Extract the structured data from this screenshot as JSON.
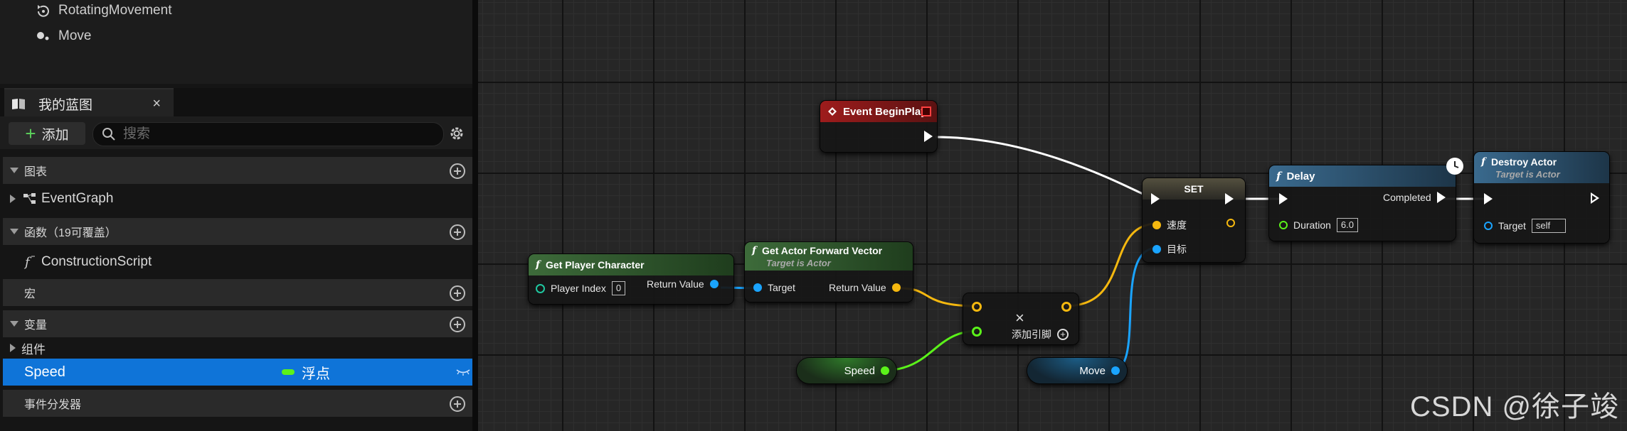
{
  "components": [
    {
      "label": "RotatingMovement",
      "icon": "rotating-movement-icon"
    },
    {
      "label": "Move",
      "icon": "move-component-icon"
    }
  ],
  "panel": {
    "tab_title": "我的蓝图",
    "close": "×",
    "add_label": "添加",
    "search_placeholder": "搜索"
  },
  "sections": {
    "graphs": "图表",
    "event_graph": "EventGraph",
    "functions": "函数（19可覆盖）",
    "construction_script": "ConstructionScript",
    "macros": "宏",
    "variables": "变量",
    "components_cat": "组件",
    "dispatchers": "事件分发器"
  },
  "variable": {
    "name": "Speed",
    "type": "浮点",
    "type_color": "#5bf21a"
  },
  "graph": {
    "begin_play": {
      "title": "Event BeginPlay"
    },
    "get_player": {
      "title": "Get Player Character",
      "player_index_label": "Player Index",
      "player_index_value": "0",
      "return_label": "Return Value"
    },
    "forward": {
      "title": "Get Actor Forward Vector",
      "subtitle": "Target is Actor",
      "target_label": "Target",
      "return_label": "Return Value"
    },
    "add": {
      "symbol": "×",
      "add_pin_label": "添加引脚"
    },
    "set": {
      "title": "SET",
      "speed_label": "速度",
      "target_label": "目标"
    },
    "delay": {
      "title": "Delay",
      "completed_label": "Completed",
      "duration_label": "Duration",
      "duration_value": "6.0"
    },
    "destroy": {
      "title": "Destroy Actor",
      "subtitle": "Target is Actor",
      "target_label": "Target",
      "target_value": "self"
    },
    "speed_var": {
      "label": "Speed"
    },
    "move_var": {
      "label": "Move"
    }
  },
  "colors": {
    "event_red": "#8b1a1a",
    "pure_green": "#2f5b2c",
    "function_blue": "#2e4d68",
    "vector_pin": "#f5b80f",
    "float_pin": "#5bf21a",
    "object_pin": "#1aa4ff",
    "selection_blue": "#0f74d8"
  },
  "watermark": "CSDN @徐子竣"
}
